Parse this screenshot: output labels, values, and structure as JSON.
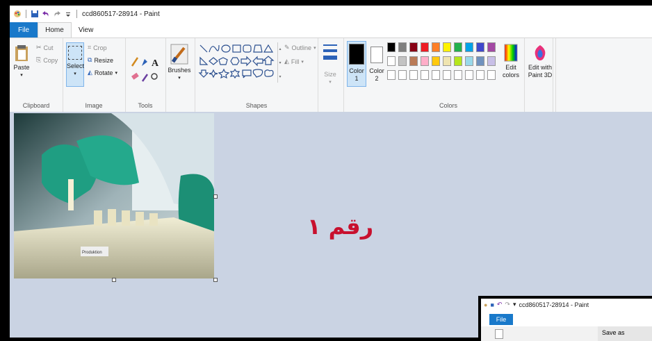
{
  "window": {
    "title": "ccd860517-28914 - Paint"
  },
  "tabs": [
    {
      "label": "File"
    },
    {
      "label": "Home"
    },
    {
      "label": "View"
    }
  ],
  "clipboard": {
    "paste": "Paste",
    "cut": "Cut",
    "copy": "Copy",
    "label": "Clipboard"
  },
  "image": {
    "select": "Select",
    "crop": "Crop",
    "resize": "Resize",
    "rotate": "Rotate",
    "label": "Image"
  },
  "tools": {
    "label": "Tools"
  },
  "brushes": {
    "label": "Brushes"
  },
  "shapes": {
    "outline": "Outline",
    "fill": "Fill",
    "label": "Shapes"
  },
  "size": {
    "label": "Size"
  },
  "colors": {
    "color1": "Color 1",
    "color1_line1": "Color",
    "color1_line2": "1",
    "color2_line1": "Color",
    "color2_line2": "2",
    "edit_line1": "Edit",
    "edit_line2": "colors",
    "label": "Colors",
    "palette_row1": [
      "#000000",
      "#7f7f7f",
      "#880015",
      "#ed1c24",
      "#ff7f27",
      "#fff200",
      "#22b14c",
      "#00a2e8",
      "#3f48cc",
      "#a349a4"
    ],
    "palette_row2": [
      "#ffffff",
      "#c3c3c3",
      "#b97a57",
      "#ffaec9",
      "#ffc90e",
      "#efe4b0",
      "#b5e61d",
      "#99d9ea",
      "#7092be",
      "#c8bfe7"
    ]
  },
  "paint3d": {
    "line1": "Edit with",
    "line2": "Paint 3D"
  },
  "canvas": {
    "photo_label": "Produktion",
    "overlay_text": "رقم ١"
  },
  "inset": {
    "title": "ccd860517-28914 - Paint",
    "file_tab": "File",
    "save_as": "Save as"
  }
}
